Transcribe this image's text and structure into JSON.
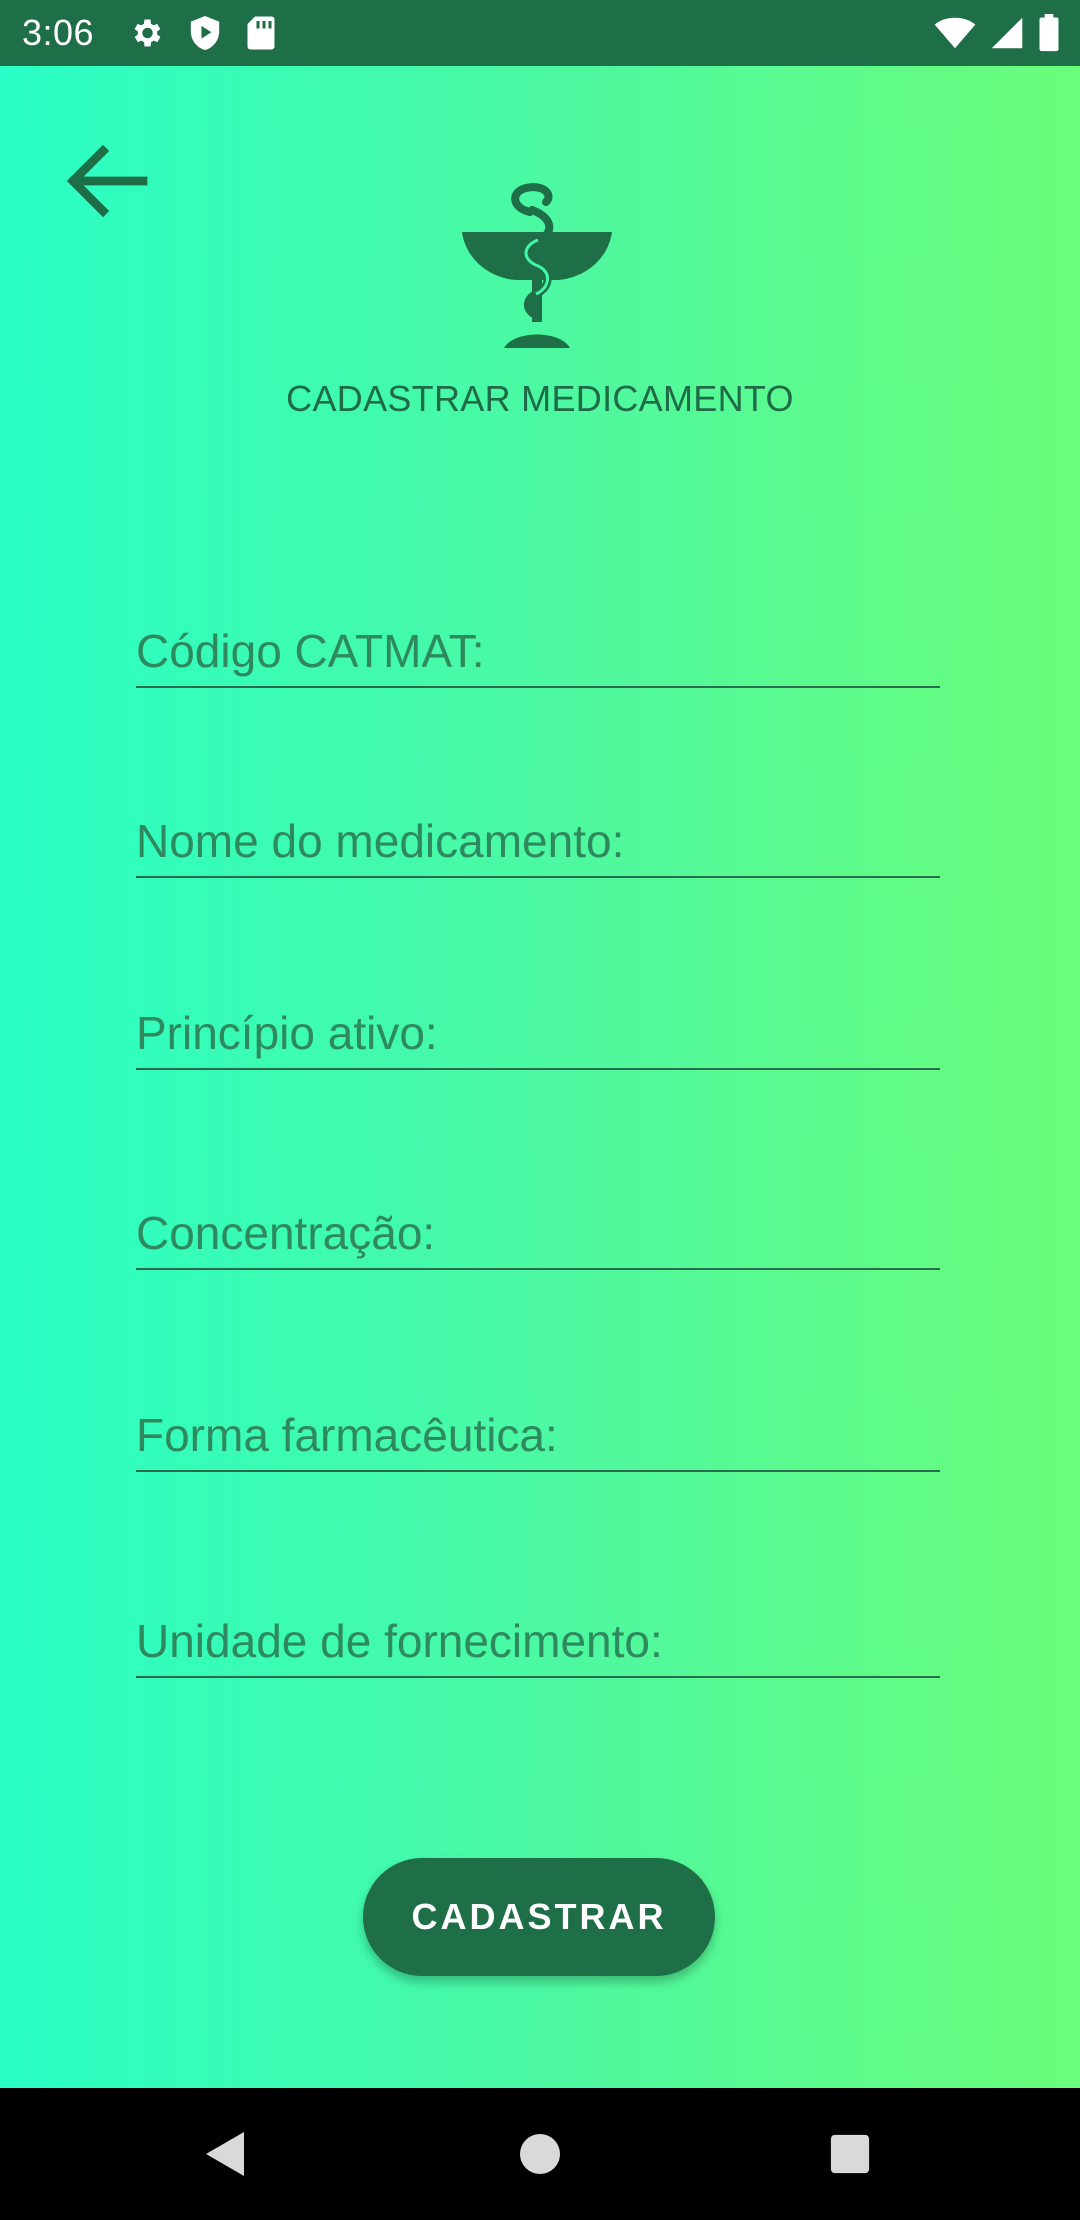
{
  "status_bar": {
    "time": "3:06",
    "left_icons": [
      "gear-icon",
      "shield-play-icon",
      "sd-card-icon"
    ],
    "right_icons": [
      "wifi-icon",
      "signal-icon",
      "battery-icon"
    ],
    "color": "#1e6f47"
  },
  "header": {
    "back_icon": "arrow-left-icon",
    "logo_icon": "pharmacy-bowl-of-hygieia-icon",
    "title": "CADASTRAR MEDICAMENTO"
  },
  "form": {
    "fields": [
      {
        "placeholder": "Código CATMAT:",
        "value": ""
      },
      {
        "placeholder": "Nome do medicamento:",
        "value": ""
      },
      {
        "placeholder": "Princípio ativo:",
        "value": ""
      },
      {
        "placeholder": "Concentração:",
        "value": ""
      },
      {
        "placeholder": "Forma farmacêutica:",
        "value": ""
      },
      {
        "placeholder": "Unidade de fornecimento:",
        "value": ""
      }
    ],
    "submit_label": "CADASTRAR"
  },
  "nav_bar": {
    "buttons": [
      "back-triangle-icon",
      "home-circle-icon",
      "recents-square-icon"
    ]
  },
  "colors": {
    "accent": "#1e6f47",
    "gradient_start": "#29ffc6",
    "gradient_end": "#6afe7a",
    "text": "#1f6a47"
  }
}
